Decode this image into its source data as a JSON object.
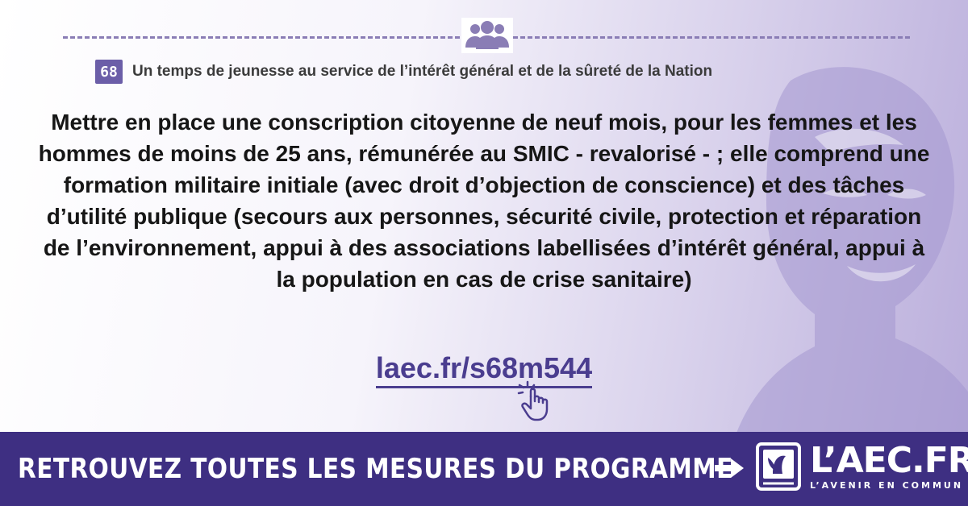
{
  "colors": {
    "accent": "#6b5ea8",
    "link": "#4a3d8f",
    "banner_background": "#3e2f82",
    "text": "#161616"
  },
  "header": {
    "icon": "people-group-icon",
    "measure_number": "68",
    "title": "Un temps de jeunesse au service de l’intérêt général et de la sûreté de la Nation"
  },
  "body": {
    "text": "Mettre en place une conscription citoyenne de neuf mois, pour les femmes et les hommes de moins de 25 ans, rémunérée au SMIC - revalorisé - ; elle comprend une formation militaire initiale (avec droit d’objection de conscience) et des tâches d’utilité publique (secours aux personnes, sécurité civile, protection et réparation de l’environnement, appui à des associations labellisées d’intérêt général, appui à la population en cas de crise sanitaire)"
  },
  "link": {
    "label": "laec.fr/s68m544",
    "icon": "hand-pointer-icon"
  },
  "banner": {
    "text": "RETROUVEZ TOUTES LES MESURES DU PROGRAMME",
    "arrow_icon": "arrow-right-icon",
    "brand_name": "L’AEC.FR",
    "brand_tagline": "L’AVENIR EN COMMUN"
  }
}
